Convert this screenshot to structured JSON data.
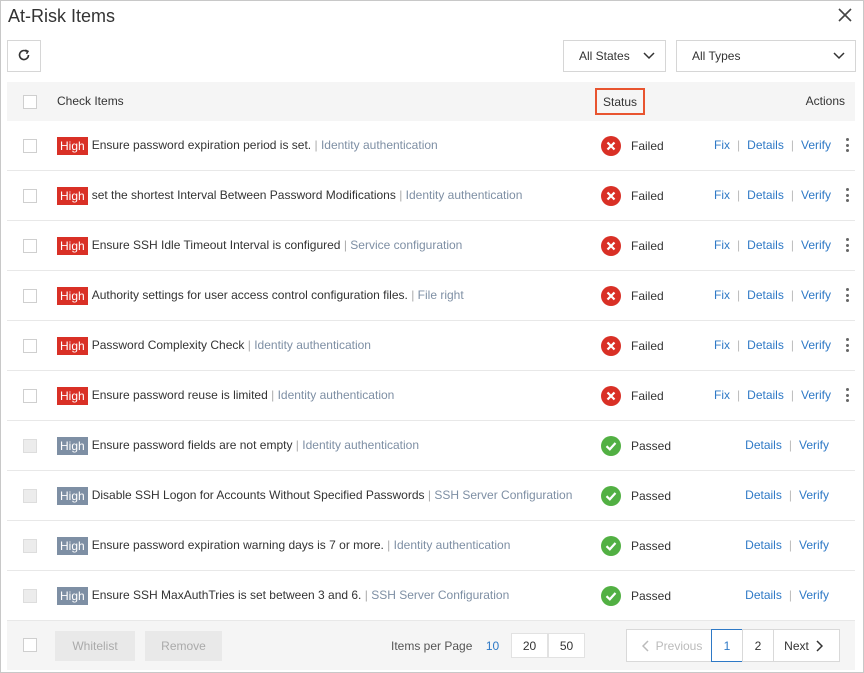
{
  "dialog": {
    "title": "At-Risk Items"
  },
  "filters": {
    "states": "All States",
    "types": "All Types"
  },
  "table": {
    "headers": {
      "check_items": "Check Items",
      "status": "Status",
      "actions": "Actions"
    },
    "rows": [
      {
        "level": "High",
        "name": "Ensure password expiration period is set.",
        "category": "Identity authentication",
        "status": "Failed"
      },
      {
        "level": "High",
        "name": "set the shortest Interval Between Password Modifications",
        "category": "Identity authentication",
        "status": "Failed"
      },
      {
        "level": "High",
        "name": "Ensure SSH Idle Timeout Interval is configured",
        "category": "Service configuration",
        "status": "Failed"
      },
      {
        "level": "High",
        "name": "Authority settings for user access control configuration files.",
        "category": "File right",
        "status": "Failed"
      },
      {
        "level": "High",
        "name": "Password Complexity Check",
        "category": "Identity authentication",
        "status": "Failed"
      },
      {
        "level": "High",
        "name": "Ensure password reuse is limited",
        "category": "Identity authentication",
        "status": "Failed"
      },
      {
        "level": "High",
        "name": "Ensure password fields are not empty",
        "category": "Identity authentication",
        "status": "Passed"
      },
      {
        "level": "High",
        "name": "Disable SSH Logon for Accounts Without Specified Passwords",
        "category": "SSH Server Configuration",
        "status": "Passed"
      },
      {
        "level": "High",
        "name": "Ensure password expiration warning days is 7 or more.",
        "category": "Identity authentication",
        "status": "Passed"
      },
      {
        "level": "High",
        "name": "Ensure SSH MaxAuthTries is set between 3 and 6.",
        "category": "SSH Server Configuration",
        "status": "Passed"
      }
    ],
    "actions": {
      "fix": "Fix",
      "details": "Details",
      "verify": "Verify"
    },
    "separator": "|"
  },
  "footer": {
    "whitelist": "Whitelist",
    "remove": "Remove",
    "items_per_page_label": "Items per Page",
    "page_sizes": [
      "10",
      "20",
      "50"
    ],
    "pagination": {
      "previous": "Previous",
      "pages": [
        "1",
        "2"
      ],
      "next": "Next",
      "current": "1"
    }
  },
  "colors": {
    "failed": "#d93026",
    "passed": "#52b043",
    "link": "#2e79c6",
    "high_passed_badge": "#7e8fa4",
    "highlight": "#e8542f"
  },
  "icons": {
    "refresh": "refresh-icon",
    "close": "close-icon",
    "failed": "x-circle-icon",
    "passed": "check-circle-icon",
    "more": "kebab-menu-icon"
  }
}
